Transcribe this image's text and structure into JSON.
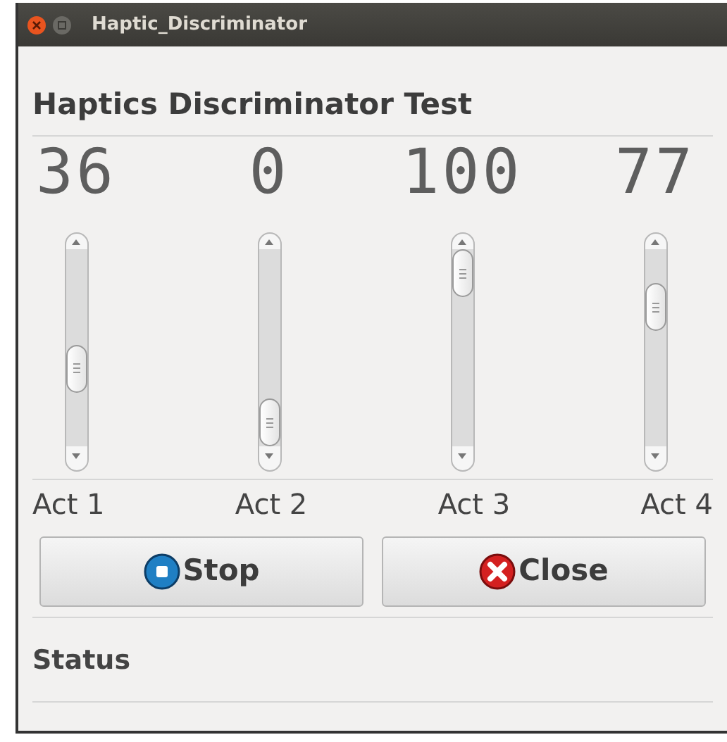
{
  "window": {
    "title": "Haptic_Discriminator"
  },
  "heading": "Haptics Discriminator Test",
  "actuators": [
    {
      "reading": "36",
      "label": "Act 1"
    },
    {
      "reading": "0",
      "label": "Act 2"
    },
    {
      "reading": "100",
      "label": "Act 3"
    },
    {
      "reading": "77",
      "label": "Act 4"
    }
  ],
  "buttons": [
    {
      "label": "Stop",
      "kind": "stop"
    },
    {
      "label": "Close",
      "kind": "close"
    }
  ],
  "status": "Status"
}
